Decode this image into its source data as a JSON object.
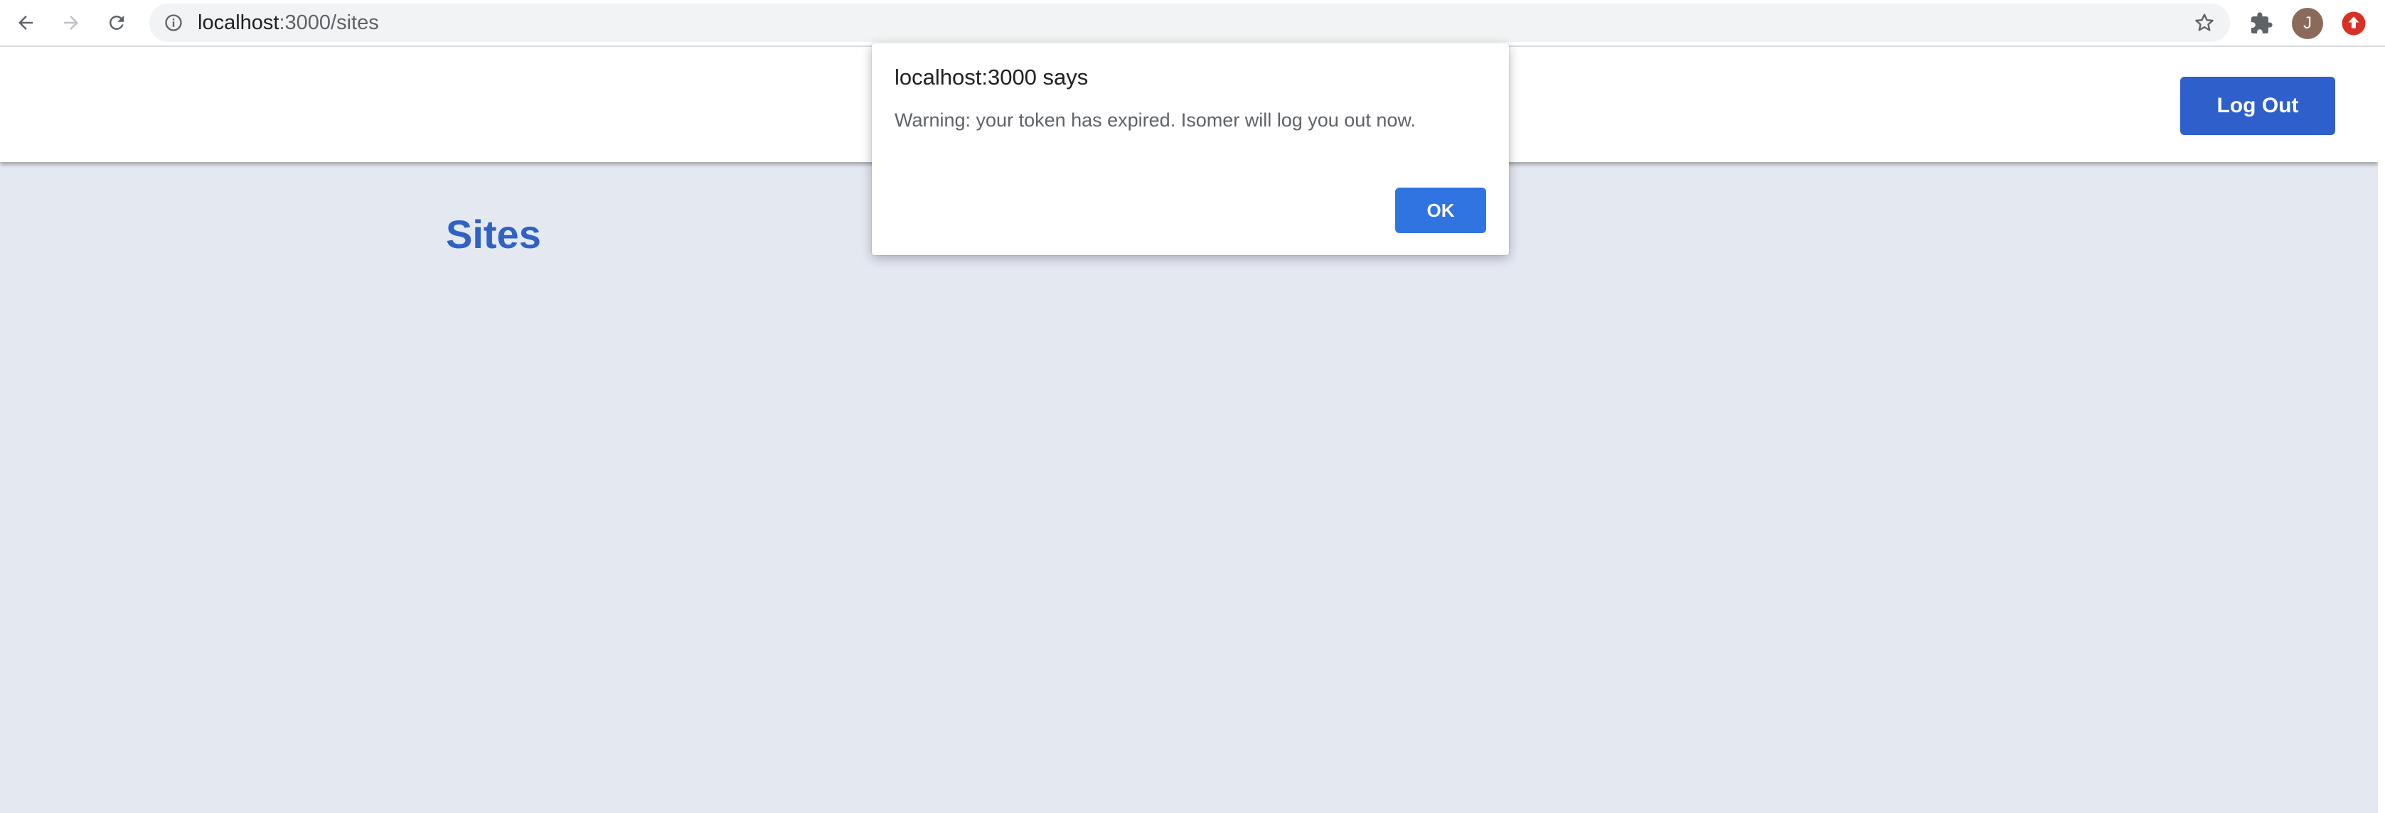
{
  "browser": {
    "url_host": "localhost",
    "url_path": ":3000/sites",
    "profile_initial": "J",
    "colors": {
      "toolbar_bg": "#ffffff",
      "omnibox_bg": "#f1f3f4",
      "icon": "#5f6368",
      "forward_disabled": "#bdc1c6",
      "avatar_bg": "#8b6a5c",
      "update_badge": "#d93025"
    },
    "icons": {
      "back": "arrow-left-icon",
      "forward": "arrow-right-icon",
      "reload": "reload-icon",
      "site_info": "info-circle-icon",
      "bookmark": "star-outline-icon",
      "extensions": "puzzle-piece-icon",
      "update": "arrow-up-circle-icon"
    }
  },
  "header": {
    "logout_label": "Log Out",
    "colors": {
      "background": "#ffffff",
      "button_bg": "#2e5fcb",
      "button_text": "#ffffff"
    }
  },
  "main": {
    "title": "Sites",
    "colors": {
      "background": "#e4e8f1",
      "title": "#2f62c4"
    }
  },
  "dialog": {
    "title": "localhost:3000 says",
    "message": "Warning: your token has expired. Isomer will log you out now.",
    "ok_label": "OK",
    "colors": {
      "ok_bg": "#2f74e0",
      "message": "#5f6368"
    }
  }
}
